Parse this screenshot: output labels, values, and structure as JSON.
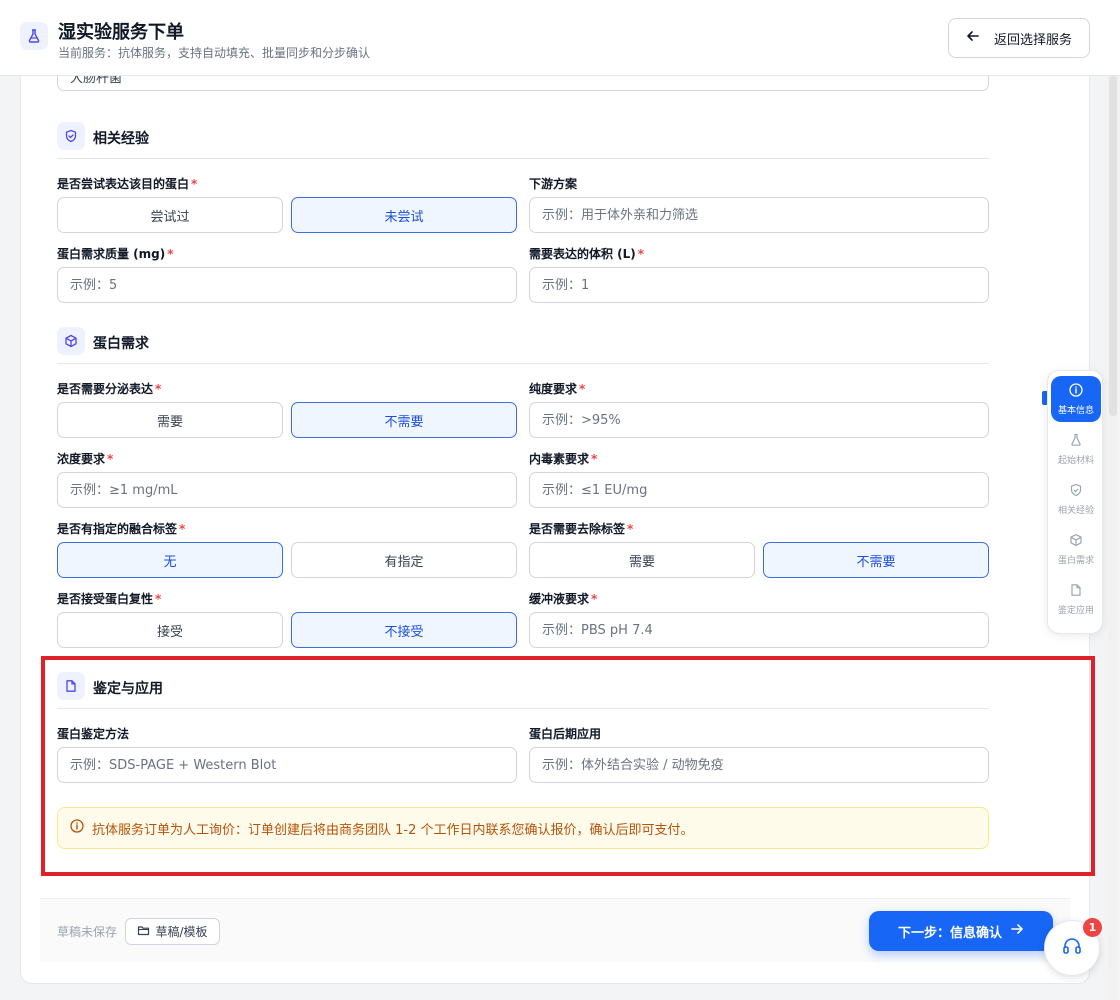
{
  "header": {
    "title": "湿实验服务下单",
    "subtitle": "当前服务：抗体服务，支持自动填充、批量同步和分步确认",
    "back_label": "返回选择服务"
  },
  "partial_field_value": "大肠杆菌",
  "sections": {
    "experience": {
      "title": "相关经验",
      "tried_label": "是否尝试表达该目的蛋白",
      "tried_options": [
        "尝试过",
        "未尝试"
      ],
      "tried_selected": "未尝试",
      "downstream_label": "下游方案",
      "downstream_placeholder": "示例：用于体外亲和力筛选",
      "mass_label": "蛋白需求质量 (mg)",
      "mass_placeholder": "示例：5",
      "volume_label": "需要表达的体积 (L)",
      "volume_placeholder": "示例：1"
    },
    "protein": {
      "title": "蛋白需求",
      "secretion_label": "是否需要分泌表达",
      "secretion_options": [
        "需要",
        "不需要"
      ],
      "secretion_selected": "不需要",
      "purity_label": "纯度要求",
      "purity_placeholder": "示例：>95%",
      "concentration_label": "浓度要求",
      "concentration_placeholder": "示例：≥1 mg/mL",
      "endotoxin_label": "内毒素要求",
      "endotoxin_placeholder": "示例：≤1 EU/mg",
      "fusion_label": "是否有指定的融合标签",
      "fusion_options": [
        "无",
        "有指定"
      ],
      "fusion_selected": "无",
      "remove_tag_label": "是否需要去除标签",
      "remove_tag_options": [
        "需要",
        "不需要"
      ],
      "remove_tag_selected": "不需要",
      "refold_label": "是否接受蛋白复性",
      "refold_options": [
        "接受",
        "不接受"
      ],
      "refold_selected": "不接受",
      "buffer_label": "缓冲液要求",
      "buffer_placeholder": "示例：PBS pH 7.4"
    },
    "identification": {
      "title": "鉴定与应用",
      "method_label": "蛋白鉴定方法",
      "method_placeholder": "示例：SDS-PAGE + Western Blot",
      "application_label": "蛋白后期应用",
      "application_placeholder": "示例：体外结合实验 / 动物免疫",
      "notice": "抗体服务订单为人工询价：订单创建后将由商务团队 1-2 个工作日内联系您确认报价，确认后即可支付。"
    }
  },
  "footer": {
    "draft_status": "草稿未保存",
    "draft_button": "草稿/模板",
    "next_button": "下一步：信息确认"
  },
  "sidenav": {
    "items": [
      "基本信息",
      "起始材料",
      "相关经验",
      "蛋白需求",
      "鉴定应用"
    ],
    "active": "基本信息"
  },
  "support": {
    "badge_count": "1"
  },
  "colors": {
    "primary": "#1766f5",
    "highlight": "#e0212a",
    "required": "#ef4444",
    "notice_text": "#b45309"
  }
}
